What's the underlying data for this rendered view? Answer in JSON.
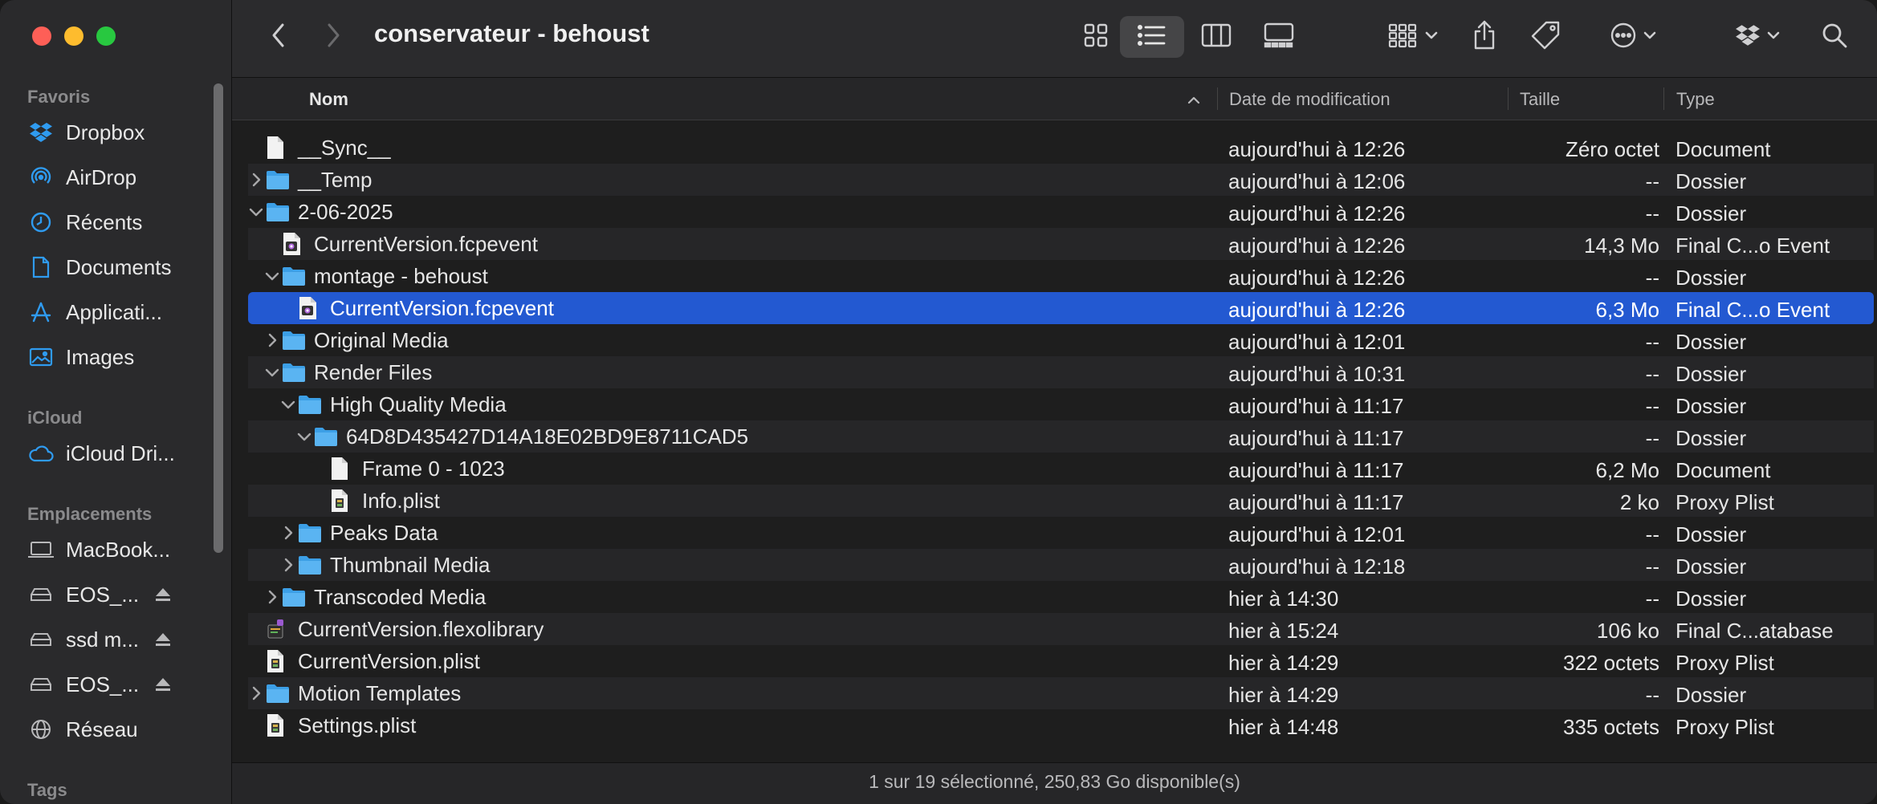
{
  "sidebar": {
    "sections": {
      "favorites": "Favoris",
      "icloud": "iCloud",
      "locations": "Emplacements",
      "tags": "Tags"
    },
    "favorites": [
      {
        "label": "Dropbox",
        "icon": "dropbox-icon"
      },
      {
        "label": "AirDrop",
        "icon": "airdrop-icon"
      },
      {
        "label": "Récents",
        "icon": "clock-icon"
      },
      {
        "label": "Documents",
        "icon": "document-icon"
      },
      {
        "label": "Applicati...",
        "icon": "applications-icon"
      },
      {
        "label": "Images",
        "icon": "photo-icon"
      }
    ],
    "icloud": [
      {
        "label": "iCloud Dri...",
        "icon": "cloud-icon"
      }
    ],
    "locations": [
      {
        "label": "MacBook...",
        "icon": "laptop-icon"
      },
      {
        "label": "EOS_...",
        "icon": "drive-icon"
      },
      {
        "label": "ssd m...",
        "icon": "drive-icon"
      },
      {
        "label": "EOS_...",
        "icon": "drive-icon"
      },
      {
        "label": "Réseau",
        "icon": "network-icon"
      }
    ]
  },
  "toolbar": {
    "title": "conservateur - behoust",
    "view_active": "list"
  },
  "columns": {
    "name": "Nom",
    "date": "Date de modification",
    "size": "Taille",
    "type": "Type"
  },
  "rows": [
    {
      "name": "__Sync__",
      "date": "aujourd'hui à 12:26",
      "size": "Zéro octet",
      "type": "Document",
      "depth": 0,
      "kind": "doc",
      "disclosure": "none"
    },
    {
      "name": "__Temp",
      "date": "aujourd'hui à 12:06",
      "size": "--",
      "type": "Dossier",
      "depth": 0,
      "kind": "folder",
      "disclosure": "collapsed"
    },
    {
      "name": "2-06-2025",
      "date": "aujourd'hui à 12:26",
      "size": "--",
      "type": "Dossier",
      "depth": 0,
      "kind": "folder",
      "disclosure": "expanded"
    },
    {
      "name": "CurrentVersion.fcpevent",
      "date": "aujourd'hui à 12:26",
      "size": "14,3 Mo",
      "type": "Final C...o Event",
      "depth": 1,
      "kind": "fcp",
      "disclosure": "none"
    },
    {
      "name": "montage - behoust",
      "date": "aujourd'hui à 12:26",
      "size": "--",
      "type": "Dossier",
      "depth": 1,
      "kind": "folder",
      "disclosure": "expanded"
    },
    {
      "name": "CurrentVersion.fcpevent",
      "date": "aujourd'hui à 12:26",
      "size": "6,3 Mo",
      "type": "Final C...o Event",
      "depth": 2,
      "kind": "fcp",
      "disclosure": "none",
      "selected": true
    },
    {
      "name": "Original Media",
      "date": "aujourd'hui à 12:01",
      "size": "--",
      "type": "Dossier",
      "depth": 1,
      "kind": "folder",
      "disclosure": "collapsed"
    },
    {
      "name": "Render Files",
      "date": "aujourd'hui à 10:31",
      "size": "--",
      "type": "Dossier",
      "depth": 1,
      "kind": "folder",
      "disclosure": "expanded"
    },
    {
      "name": "High Quality Media",
      "date": "aujourd'hui à 11:17",
      "size": "--",
      "type": "Dossier",
      "depth": 2,
      "kind": "folder",
      "disclosure": "expanded"
    },
    {
      "name": "64D8D435427D14A18E02BD9E8711CAD5",
      "date": "aujourd'hui à 11:17",
      "size": "--",
      "type": "Dossier",
      "depth": 3,
      "kind": "folder",
      "disclosure": "expanded"
    },
    {
      "name": "Frame 0 - 1023",
      "date": "aujourd'hui à 11:17",
      "size": "6,2 Mo",
      "type": "Document",
      "depth": 4,
      "kind": "doc",
      "disclosure": "none"
    },
    {
      "name": "Info.plist",
      "date": "aujourd'hui à 11:17",
      "size": "2 ko",
      "type": "Proxy Plist",
      "depth": 4,
      "kind": "plist",
      "disclosure": "none"
    },
    {
      "name": "Peaks Data",
      "date": "aujourd'hui à 12:01",
      "size": "--",
      "type": "Dossier",
      "depth": 2,
      "kind": "folder",
      "disclosure": "collapsed"
    },
    {
      "name": "Thumbnail Media",
      "date": "aujourd'hui à 12:18",
      "size": "--",
      "type": "Dossier",
      "depth": 2,
      "kind": "folder",
      "disclosure": "collapsed"
    },
    {
      "name": "Transcoded Media",
      "date": "hier à 14:30",
      "size": "--",
      "type": "Dossier",
      "depth": 1,
      "kind": "folder",
      "disclosure": "collapsed"
    },
    {
      "name": "CurrentVersion.flexolibrary",
      "date": "hier à 15:24",
      "size": "106 ko",
      "type": "Final C...atabase",
      "depth": 0,
      "kind": "flexo",
      "disclosure": "none"
    },
    {
      "name": "CurrentVersion.plist",
      "date": "hier à 14:29",
      "size": "322 octets",
      "type": "Proxy Plist",
      "depth": 0,
      "kind": "plist",
      "disclosure": "none"
    },
    {
      "name": "Motion Templates",
      "date": "hier à 14:29",
      "size": "--",
      "type": "Dossier",
      "depth": 0,
      "kind": "folder",
      "disclosure": "collapsed"
    },
    {
      "name": "Settings.plist",
      "date": "hier à 14:48",
      "size": "335 octets",
      "type": "Proxy Plist",
      "depth": 0,
      "kind": "plist",
      "disclosure": "none"
    }
  ],
  "status": "1 sur 19 sélectionné, 250,83 Go disponible(s)",
  "colors": {
    "selection": "#2359d1",
    "folder": "#5ab4f2",
    "accent_icon": "#2f9bf0"
  }
}
